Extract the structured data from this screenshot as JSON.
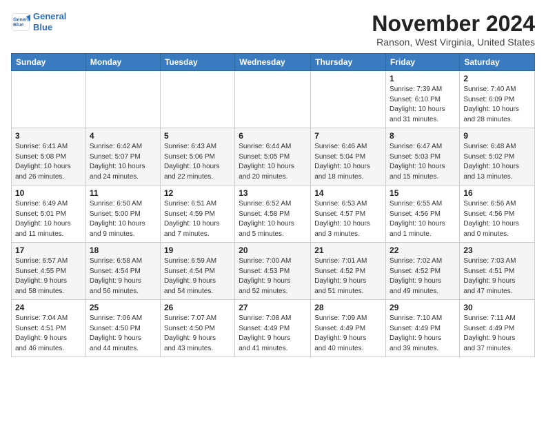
{
  "header": {
    "logo_line1": "General",
    "logo_line2": "Blue",
    "month": "November 2024",
    "location": "Ranson, West Virginia, United States"
  },
  "weekdays": [
    "Sunday",
    "Monday",
    "Tuesday",
    "Wednesday",
    "Thursday",
    "Friday",
    "Saturday"
  ],
  "weeks": [
    [
      {
        "day": "",
        "info": ""
      },
      {
        "day": "",
        "info": ""
      },
      {
        "day": "",
        "info": ""
      },
      {
        "day": "",
        "info": ""
      },
      {
        "day": "",
        "info": ""
      },
      {
        "day": "1",
        "info": "Sunrise: 7:39 AM\nSunset: 6:10 PM\nDaylight: 10 hours\nand 31 minutes."
      },
      {
        "day": "2",
        "info": "Sunrise: 7:40 AM\nSunset: 6:09 PM\nDaylight: 10 hours\nand 28 minutes."
      }
    ],
    [
      {
        "day": "3",
        "info": "Sunrise: 6:41 AM\nSunset: 5:08 PM\nDaylight: 10 hours\nand 26 minutes."
      },
      {
        "day": "4",
        "info": "Sunrise: 6:42 AM\nSunset: 5:07 PM\nDaylight: 10 hours\nand 24 minutes."
      },
      {
        "day": "5",
        "info": "Sunrise: 6:43 AM\nSunset: 5:06 PM\nDaylight: 10 hours\nand 22 minutes."
      },
      {
        "day": "6",
        "info": "Sunrise: 6:44 AM\nSunset: 5:05 PM\nDaylight: 10 hours\nand 20 minutes."
      },
      {
        "day": "7",
        "info": "Sunrise: 6:46 AM\nSunset: 5:04 PM\nDaylight: 10 hours\nand 18 minutes."
      },
      {
        "day": "8",
        "info": "Sunrise: 6:47 AM\nSunset: 5:03 PM\nDaylight: 10 hours\nand 15 minutes."
      },
      {
        "day": "9",
        "info": "Sunrise: 6:48 AM\nSunset: 5:02 PM\nDaylight: 10 hours\nand 13 minutes."
      }
    ],
    [
      {
        "day": "10",
        "info": "Sunrise: 6:49 AM\nSunset: 5:01 PM\nDaylight: 10 hours\nand 11 minutes."
      },
      {
        "day": "11",
        "info": "Sunrise: 6:50 AM\nSunset: 5:00 PM\nDaylight: 10 hours\nand 9 minutes."
      },
      {
        "day": "12",
        "info": "Sunrise: 6:51 AM\nSunset: 4:59 PM\nDaylight: 10 hours\nand 7 minutes."
      },
      {
        "day": "13",
        "info": "Sunrise: 6:52 AM\nSunset: 4:58 PM\nDaylight: 10 hours\nand 5 minutes."
      },
      {
        "day": "14",
        "info": "Sunrise: 6:53 AM\nSunset: 4:57 PM\nDaylight: 10 hours\nand 3 minutes."
      },
      {
        "day": "15",
        "info": "Sunrise: 6:55 AM\nSunset: 4:56 PM\nDaylight: 10 hours\nand 1 minute."
      },
      {
        "day": "16",
        "info": "Sunrise: 6:56 AM\nSunset: 4:56 PM\nDaylight: 10 hours\nand 0 minutes."
      }
    ],
    [
      {
        "day": "17",
        "info": "Sunrise: 6:57 AM\nSunset: 4:55 PM\nDaylight: 9 hours\nand 58 minutes."
      },
      {
        "day": "18",
        "info": "Sunrise: 6:58 AM\nSunset: 4:54 PM\nDaylight: 9 hours\nand 56 minutes."
      },
      {
        "day": "19",
        "info": "Sunrise: 6:59 AM\nSunset: 4:54 PM\nDaylight: 9 hours\nand 54 minutes."
      },
      {
        "day": "20",
        "info": "Sunrise: 7:00 AM\nSunset: 4:53 PM\nDaylight: 9 hours\nand 52 minutes."
      },
      {
        "day": "21",
        "info": "Sunrise: 7:01 AM\nSunset: 4:52 PM\nDaylight: 9 hours\nand 51 minutes."
      },
      {
        "day": "22",
        "info": "Sunrise: 7:02 AM\nSunset: 4:52 PM\nDaylight: 9 hours\nand 49 minutes."
      },
      {
        "day": "23",
        "info": "Sunrise: 7:03 AM\nSunset: 4:51 PM\nDaylight: 9 hours\nand 47 minutes."
      }
    ],
    [
      {
        "day": "24",
        "info": "Sunrise: 7:04 AM\nSunset: 4:51 PM\nDaylight: 9 hours\nand 46 minutes."
      },
      {
        "day": "25",
        "info": "Sunrise: 7:06 AM\nSunset: 4:50 PM\nDaylight: 9 hours\nand 44 minutes."
      },
      {
        "day": "26",
        "info": "Sunrise: 7:07 AM\nSunset: 4:50 PM\nDaylight: 9 hours\nand 43 minutes."
      },
      {
        "day": "27",
        "info": "Sunrise: 7:08 AM\nSunset: 4:49 PM\nDaylight: 9 hours\nand 41 minutes."
      },
      {
        "day": "28",
        "info": "Sunrise: 7:09 AM\nSunset: 4:49 PM\nDaylight: 9 hours\nand 40 minutes."
      },
      {
        "day": "29",
        "info": "Sunrise: 7:10 AM\nSunset: 4:49 PM\nDaylight: 9 hours\nand 39 minutes."
      },
      {
        "day": "30",
        "info": "Sunrise: 7:11 AM\nSunset: 4:49 PM\nDaylight: 9 hours\nand 37 minutes."
      }
    ]
  ]
}
